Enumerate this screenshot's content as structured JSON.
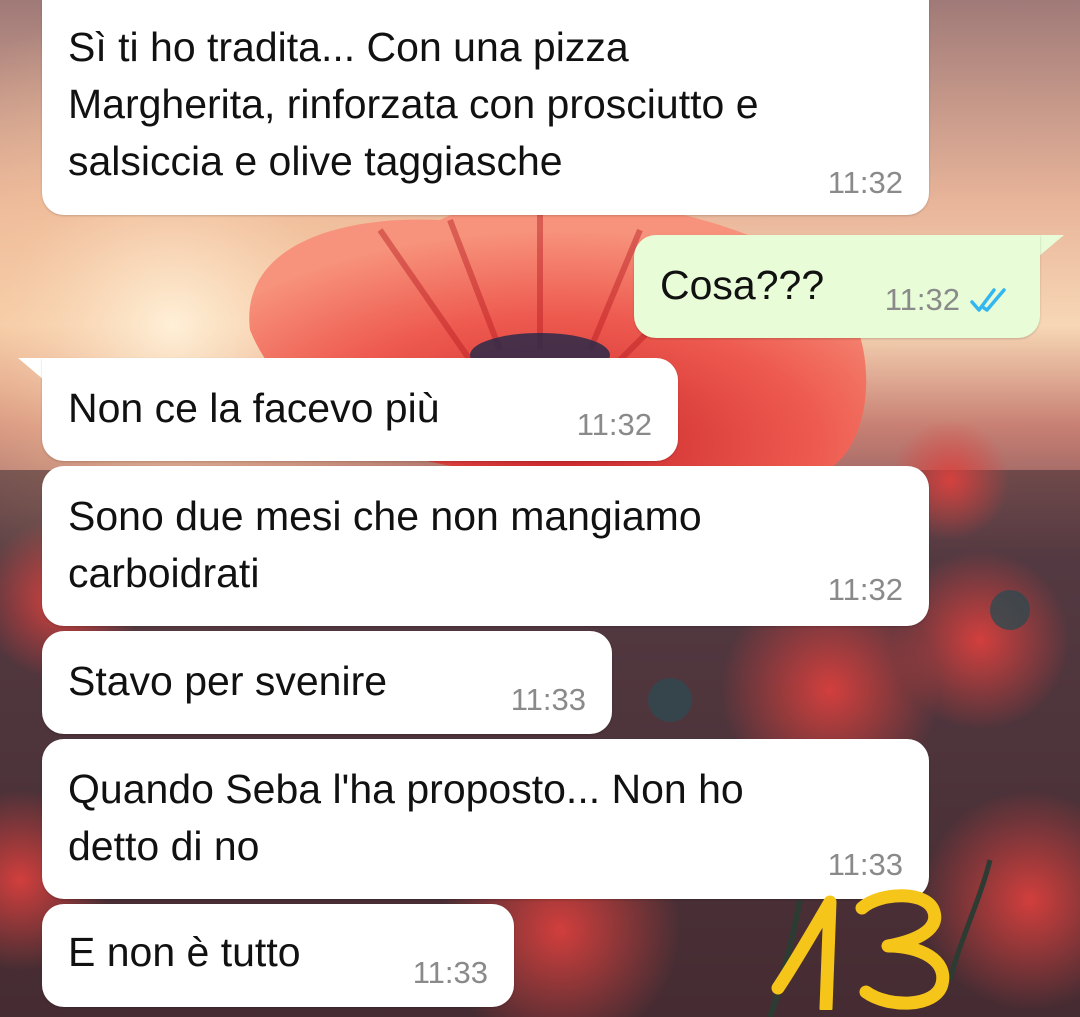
{
  "messages": [
    {
      "direction": "in",
      "text": "Sì ti ho tradita... Con una pizza\nMargherita, rinforzata con prosciutto e\nsalsiccia e olive taggiasche",
      "time": "11:32"
    },
    {
      "direction": "out",
      "text": "Cosa???",
      "time": "11:32",
      "status": "read"
    },
    {
      "direction": "in",
      "text": "Non ce la facevo più",
      "time": "11:32"
    },
    {
      "direction": "in",
      "text": "Sono due mesi che non mangiamo\ncarboidrati",
      "time": "11:32"
    },
    {
      "direction": "in",
      "text": "Stavo per svenire",
      "time": "11:33"
    },
    {
      "direction": "in",
      "text": "Quando Seba l'ha proposto... Non ho\ndetto di no",
      "time": "11:33"
    },
    {
      "direction": "in",
      "text": "E non è tutto",
      "time": "11:33"
    }
  ],
  "overlay": {
    "text": "13",
    "color": "#f6c51a"
  },
  "colors": {
    "incoming_bubble": "#ffffff",
    "outgoing_bubble": "#e7fcd7",
    "read_ticks": "#34b7f1",
    "timestamp": "#8a8a8a"
  }
}
